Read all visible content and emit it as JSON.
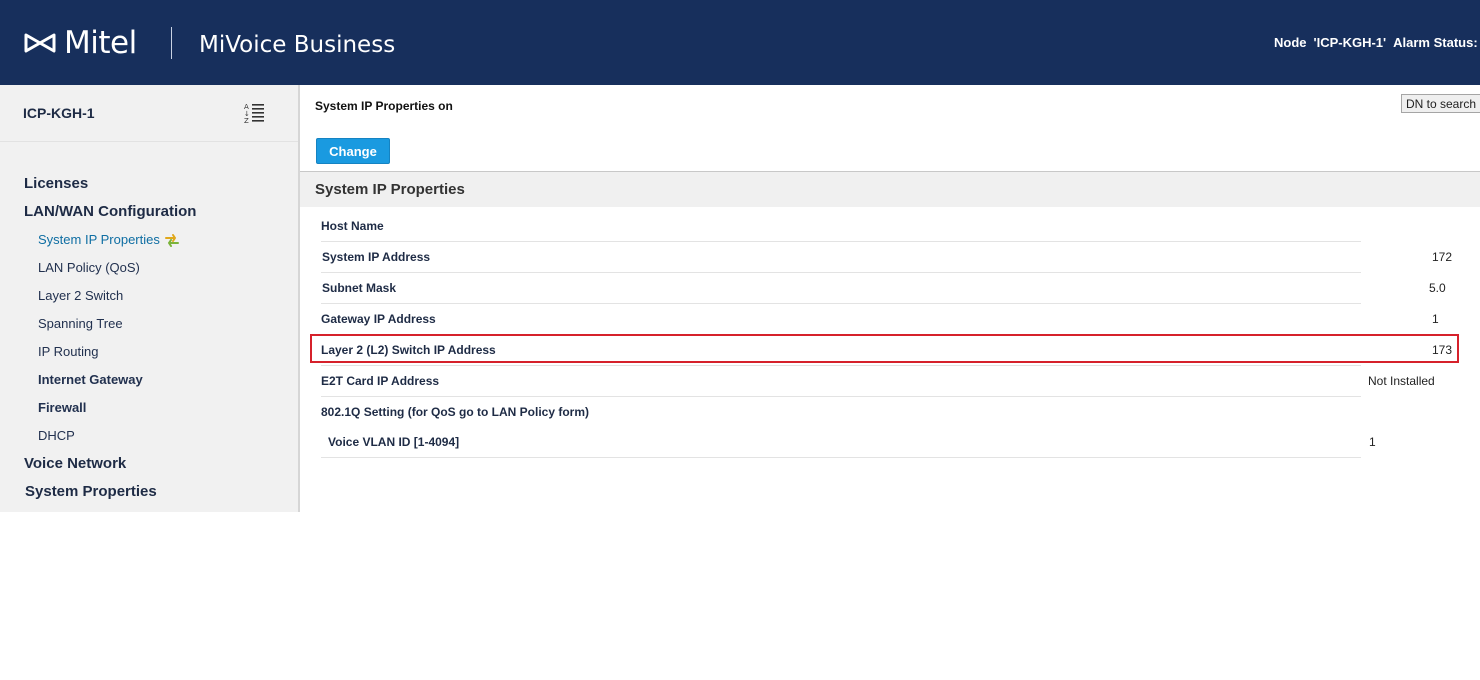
{
  "header": {
    "logo_text": "Mitel",
    "product_name": "MiVoice Business",
    "node_label": "Node",
    "node_value": "'ICP-KGH-1'",
    "alarm_label": "Alarm Status:"
  },
  "sidebar": {
    "node_name": "ICP-KGH-1",
    "sort_icon": "sort-alpha-icon",
    "items": [
      {
        "label": "Licenses"
      },
      {
        "label": "LAN/WAN Configuration"
      },
      {
        "label": "System IP Properties"
      },
      {
        "label": "LAN Policy (QoS)"
      },
      {
        "label": "Layer 2 Switch"
      },
      {
        "label": "Spanning Tree"
      },
      {
        "label": "IP Routing"
      },
      {
        "label": "Internet Gateway"
      },
      {
        "label": "Firewall"
      },
      {
        "label": "DHCP"
      },
      {
        "label": "Voice Network"
      },
      {
        "label": "System Properties"
      }
    ]
  },
  "main": {
    "caption": "System IP Properties on",
    "dn_search": "DN to search",
    "change_button": "Change",
    "section_title": "System IP Properties",
    "properties": [
      {
        "label": "Host Name",
        "value": ""
      },
      {
        "label": "System IP Address",
        "value": "172"
      },
      {
        "label": "Subnet Mask",
        "value": "5.0"
      },
      {
        "label": "Gateway IP Address",
        "value": "1"
      },
      {
        "label": "Layer 2 (L2) Switch IP Address",
        "value": "173"
      },
      {
        "label": "E2T Card IP Address",
        "value": "Not Installed"
      },
      {
        "label": "802.1Q Setting (for QoS go to LAN Policy form)",
        "value": ""
      },
      {
        "label": "Voice VLAN ID [1-4094]",
        "value": "1"
      }
    ]
  },
  "colors": {
    "header_bg": "#172f5c",
    "accent": "#1a9ae0",
    "active_link": "#0f6ea3",
    "highlight": "#d6212b"
  }
}
